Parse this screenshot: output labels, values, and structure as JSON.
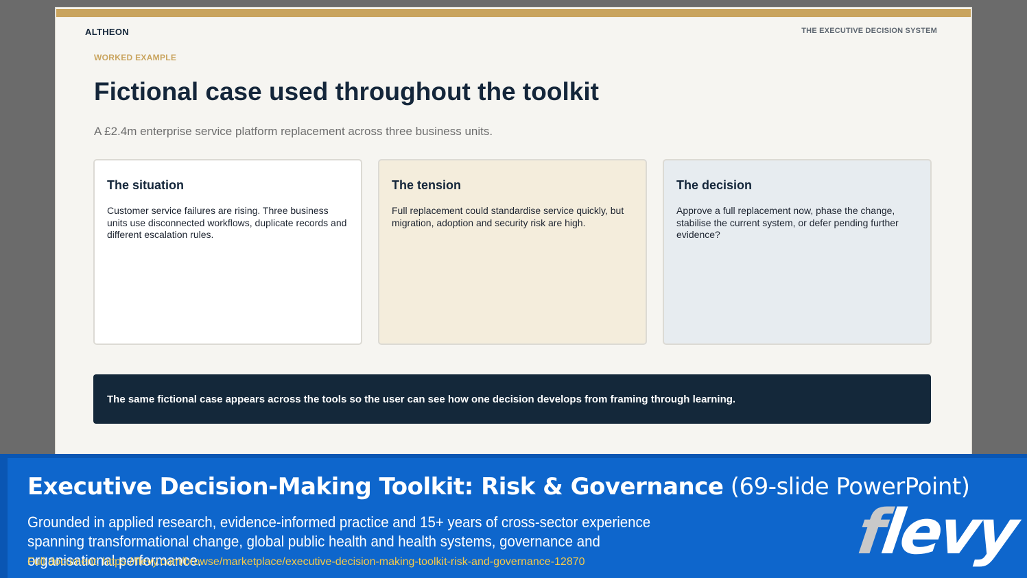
{
  "slide": {
    "brand": "ALTHEON",
    "system_label": "THE EXECUTIVE DECISION SYSTEM",
    "eyebrow": "WORKED EXAMPLE",
    "title": "Fictional case used throughout the toolkit",
    "subtitle": "A £2.4m enterprise service platform replacement across three business units.",
    "cards": [
      {
        "title": "The situation",
        "body": "Customer service failures are rising. Three business units use disconnected workflows, duplicate records and different escalation rules."
      },
      {
        "title": "The tension",
        "body": "Full replacement could standardise service quickly, but migration, adoption and security risk are high."
      },
      {
        "title": "The decision",
        "body": "Approve a full replacement now, phase the change, stabilise the current system, or defer pending further evidence?"
      }
    ],
    "banner": "The same fictional case appears across the tools so the user can see how one decision develops from framing through learning."
  },
  "footer": {
    "title_main": "Executive Decision-Making Toolkit: Risk & Governance",
    "title_suffix": "(69-slide PowerPoint)",
    "description": "Grounded in applied research, evidence-informed practice and 15+ years of cross-sector experience spanning transformational change, global public health and health systems, governance and organisational performance.",
    "link": "Full document: https://flevy.com/browse/marketplace/executive-decision-making-toolkit-risk-and-governance-12870",
    "logo_f": "f",
    "logo_rest": "levy"
  },
  "colors": {
    "accent_gold": "#c9a45e",
    "navy": "#14283a",
    "footer_blue": "#0e66cc",
    "link_yellow": "#f2c94c"
  }
}
